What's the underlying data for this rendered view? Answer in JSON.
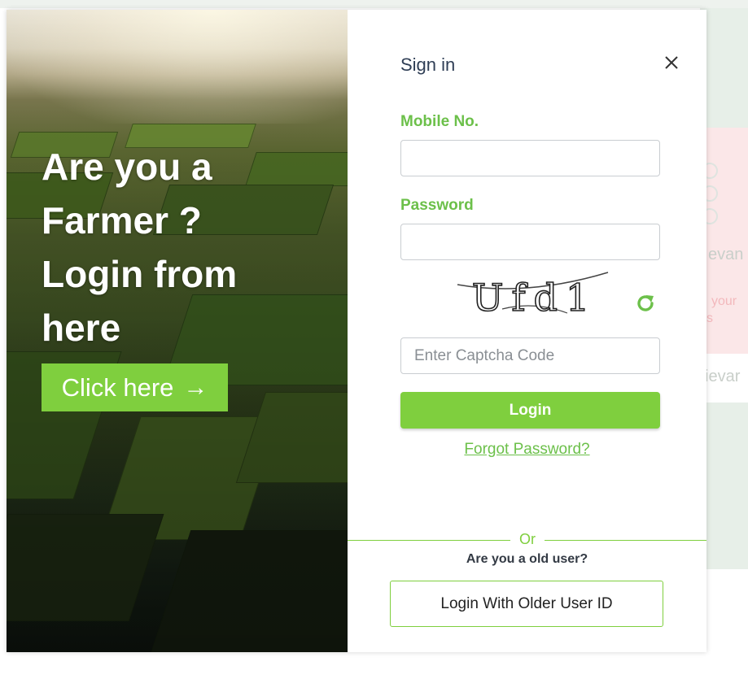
{
  "hero": {
    "title": "Are you a Farmer ? Login from here",
    "click_label": "Click here",
    "arrow_icon": "arrow-right-icon"
  },
  "form": {
    "title": "Sign in",
    "mobile_label": "Mobile No.",
    "mobile_value": "",
    "password_label": "Password",
    "password_value": "",
    "captcha_text": "Ufd1",
    "captcha_placeholder": "Enter Captcha Code",
    "login_label": "Login",
    "forgot_label": "Forgot Password?",
    "or_label": "Or",
    "old_user_label": "Are you a old user?",
    "older_login_label": "Login With Older User ID"
  },
  "background": {
    "fragment_1": "evan",
    "fragment_2": "your",
    "fragment_3": "s",
    "fragment_4": "ievar"
  },
  "colors": {
    "accent_green": "#7fcf3e",
    "label_green": "#6cc04a",
    "title_navy": "#2f3e55"
  }
}
